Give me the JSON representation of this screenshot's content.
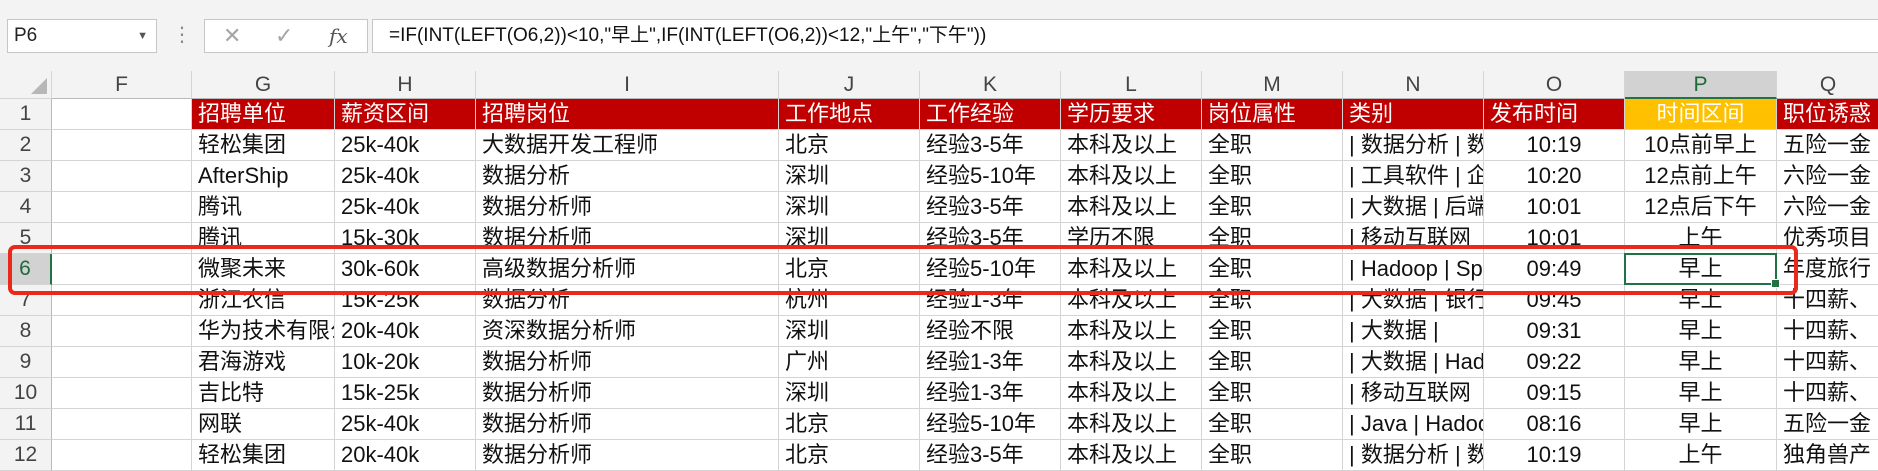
{
  "name_box": "P6",
  "formula_bar": {
    "formula": "=IF(INT(LEFT(O6,2))<10,\"早上\",IF(INT(LEFT(O6,2))<12,\"上午\",\"下午\"))",
    "cancel_symbol": "✕",
    "enter_symbol": "✓",
    "fx_symbol": "fx",
    "dots_symbol": "⋮"
  },
  "columns": [
    "F",
    "G",
    "H",
    "I",
    "J",
    "K",
    "L",
    "M",
    "N",
    "O",
    "P",
    "Q"
  ],
  "selected_column": "P",
  "selected_row": "6",
  "rows": [
    {
      "num": "1",
      "cells": [
        "",
        "招聘单位",
        "薪资区间",
        "招聘岗位",
        "工作地点",
        "工作经验",
        "学历要求",
        "岗位属性",
        "类别",
        "发布时间",
        "时间区间",
        "职位诱惑"
      ]
    },
    {
      "num": "2",
      "cells": [
        "",
        "轻松集团",
        "25k-40k",
        "大数据开发工程师",
        "北京",
        "经验3-5年",
        "本科及以上",
        "全职",
        "| 数据分析 | 数据",
        "10:19",
        "10点前早上",
        "五险一金"
      ]
    },
    {
      "num": "3",
      "cells": [
        "",
        "AfterShip",
        "25k-40k",
        "数据分析",
        "深圳",
        "经验5-10年",
        "本科及以上",
        "全职",
        "| 工具软件 | 企业",
        "10:20",
        "12点前上午",
        "六险一金"
      ]
    },
    {
      "num": "4",
      "cells": [
        "",
        "腾讯",
        "25k-40k",
        "数据分析师",
        "深圳",
        "经验3-5年",
        "本科及以上",
        "全职",
        "| 大数据 | 后端",
        "10:01",
        "12点后下午",
        "六险一金"
      ]
    },
    {
      "num": "5",
      "cells": [
        "",
        "腾讯",
        "15k-30k",
        "数据分析师",
        "深圳",
        "经验3-5年",
        "学历不限",
        "全职",
        "| 移动互联网",
        "10:01",
        "上午",
        "优秀项目"
      ]
    },
    {
      "num": "6",
      "cells": [
        "",
        "微聚未来",
        "30k-60k",
        "高级数据分析师",
        "北京",
        "经验5-10年",
        "本科及以上",
        "全职",
        "| Hadoop | Spark",
        "09:49",
        "早上",
        "年度旅行"
      ]
    },
    {
      "num": "7",
      "cells": [
        "",
        "浙江农信",
        "15k-25k",
        "数据分析",
        "杭州",
        "经验1-3年",
        "本科及以上",
        "全职",
        "| 大数据 | 银行",
        "09:45",
        "早上",
        "十四薪、"
      ]
    },
    {
      "num": "8",
      "cells": [
        "",
        "华为技术有限公司",
        "20k-40k",
        "资深数据分析师",
        "深圳",
        "经验不限",
        "本科及以上",
        "全职",
        "| 大数据 |",
        "09:31",
        "早上",
        "十四薪、"
      ]
    },
    {
      "num": "9",
      "cells": [
        "",
        "君海游戏",
        "10k-20k",
        "数据分析师",
        "广州",
        "经验1-3年",
        "本科及以上",
        "全职",
        "| 大数据 | Hadoop",
        "09:22",
        "早上",
        "十四薪、"
      ]
    },
    {
      "num": "10",
      "cells": [
        "",
        "吉比特",
        "15k-25k",
        "数据分析师",
        "深圳",
        "经验1-3年",
        "本科及以上",
        "全职",
        "| 移动互联网",
        "09:15",
        "早上",
        "十四薪、"
      ]
    },
    {
      "num": "11",
      "cells": [
        "",
        "网联",
        "25k-40k",
        "数据分析师",
        "北京",
        "经验5-10年",
        "本科及以上",
        "全职",
        "| Java | Hadoop",
        "08:16",
        "早上",
        "五险一金"
      ]
    },
    {
      "num": "12",
      "cells": [
        "",
        "轻松集团",
        "20k-40k",
        "数据分析师",
        "北京",
        "经验3-5年",
        "本科及以上",
        "全职",
        "| 数据分析 | 数据",
        "10:19",
        "上午",
        "独角兽产"
      ]
    }
  ],
  "colors": {
    "header_red": "#c00000",
    "header_gold": "#ffc000",
    "select_green": "#217346",
    "highlight_red": "#e8291c"
  }
}
